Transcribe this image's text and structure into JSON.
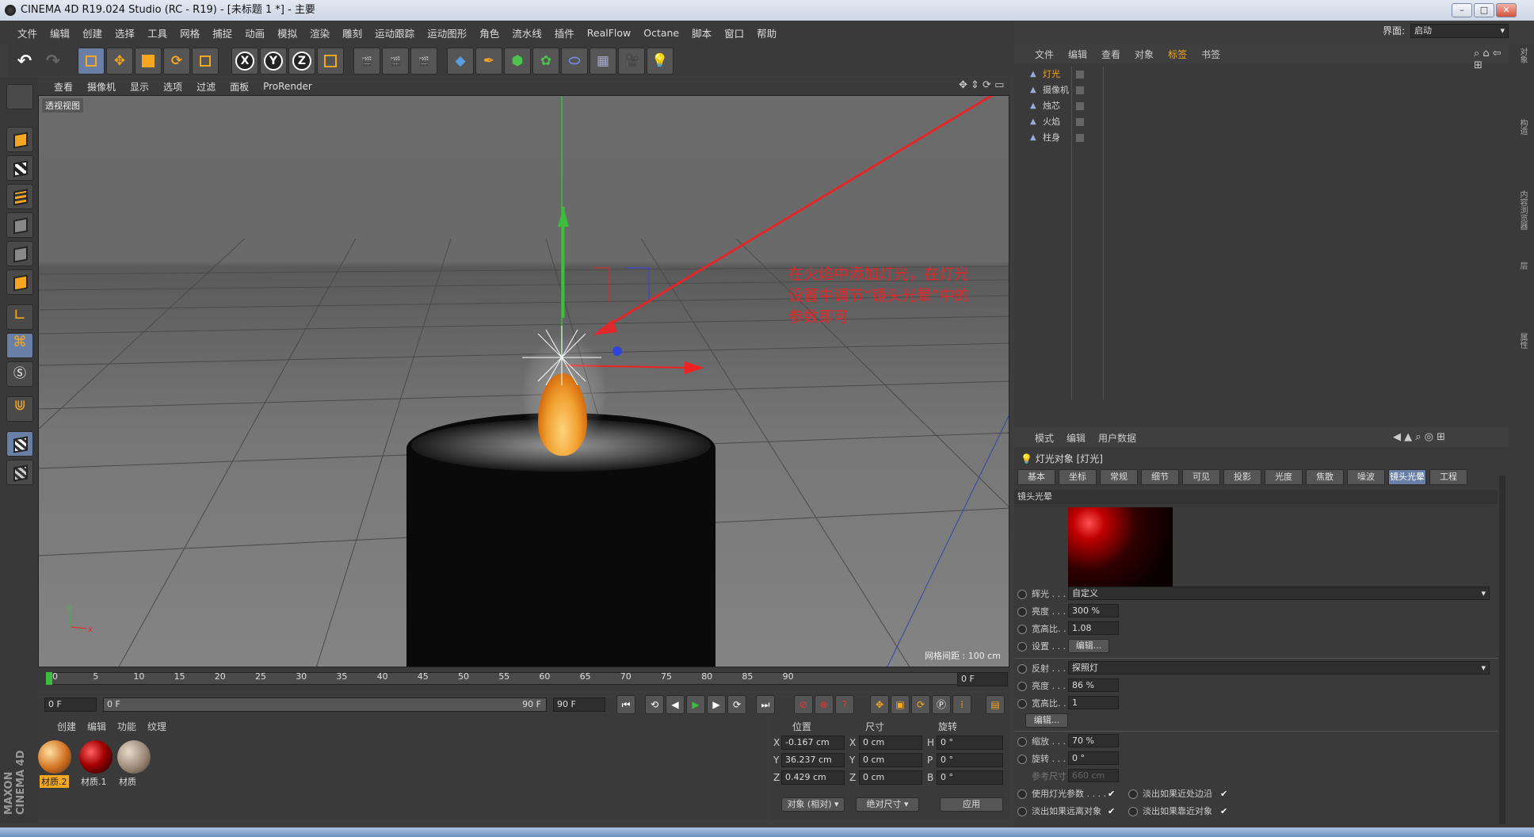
{
  "window": {
    "title": "CINEMA 4D R19.024 Studio (RC - R19) - [未标题 1 *] - 主要"
  },
  "menu": [
    "文件",
    "编辑",
    "创建",
    "选择",
    "工具",
    "网格",
    "捕捉",
    "动画",
    "模拟",
    "渲染",
    "雕刻",
    "运动跟踪",
    "运动图形",
    "角色",
    "流水线",
    "插件",
    "RealFlow",
    "Octane",
    "脚本",
    "窗口",
    "帮助"
  ],
  "interface": {
    "label": "界面:",
    "value": "启动"
  },
  "toolbar": {
    "x_label": "X",
    "y_label": "Y",
    "z_label": "Z"
  },
  "viewport": {
    "menu": [
      "查看",
      "摄像机",
      "显示",
      "选项",
      "过滤",
      "面板",
      "ProRender"
    ],
    "view_label": "透视视图",
    "grid_spacing": "网格间距 : 100 cm",
    "annotation": "在火焰中添加灯光，在灯光设置中调节“镜头光晕”中的参数即可"
  },
  "timeline": {
    "ticks": [
      "0",
      "5",
      "10",
      "15",
      "20",
      "25",
      "30",
      "35",
      "40",
      "45",
      "50",
      "55",
      "60",
      "65",
      "70",
      "75",
      "80",
      "85",
      "90"
    ],
    "current_frame": "0 F",
    "start": "0 F",
    "range_start": "0 F",
    "range_end": "90 F",
    "end": "90 F"
  },
  "materials": {
    "menu": [
      "创建",
      "编辑",
      "功能",
      "纹理"
    ],
    "items": [
      {
        "label": "材质.2",
        "color": "#a06030"
      },
      {
        "label": "材质.1",
        "color": "#8a0000"
      },
      {
        "label": "材质",
        "color": "#8b7b6b"
      }
    ],
    "brand": "MAXON CINEMA 4D"
  },
  "coords": {
    "headers": [
      "位置",
      "尺寸",
      "旋转"
    ],
    "rows": [
      {
        "axis": "X",
        "pos": "-0.167 cm",
        "size_axis": "X",
        "size": "0 cm",
        "rot_axis": "H",
        "rot": "0 °"
      },
      {
        "axis": "Y",
        "pos": "36.237 cm",
        "size_axis": "Y",
        "size": "0 cm",
        "rot_axis": "P",
        "rot": "0 °"
      },
      {
        "axis": "Z",
        "pos": "0.429 cm",
        "size_axis": "Z",
        "size": "0 cm",
        "rot_axis": "B",
        "rot": "0 °"
      }
    ],
    "mode": "对象 (相对)",
    "size_mode": "绝对尺寸",
    "apply": "应用"
  },
  "object_manager": {
    "menu": [
      "文件",
      "编辑",
      "查看",
      "对象",
      "标签",
      "书签"
    ],
    "objects": [
      "灯光",
      "摄像机",
      "烛芯",
      "火焰",
      "柱身"
    ]
  },
  "attributes": {
    "menu": [
      "模式",
      "编辑",
      "用户数据"
    ],
    "object_title": "灯光对象 [灯光]",
    "tabs": [
      "基本",
      "坐标",
      "常规",
      "细节",
      "可见",
      "投影",
      "光度",
      "焦散",
      "噪波",
      "镜头光晕",
      "工程"
    ],
    "active_tab": "镜头光晕",
    "section": "镜头光晕",
    "rows": {
      "glow_label": "辉光 . . .",
      "glow_value": "自定义",
      "brightness_label": "亮度 . . .",
      "brightness_value": "300 %",
      "aspect_label": "宽高比. .",
      "aspect_value": "1.08",
      "settings_label": "设置 . . .",
      "settings_btn": "编辑...",
      "reflex_label": "反射 . . .",
      "reflex_value": "探照灯",
      "brightness2_label": "亮度 . . .",
      "brightness2_value": "86 %",
      "aspect2_label": "宽高比. .",
      "aspect2_value": "1",
      "edit_btn": "编辑...",
      "scale_label": "缩放 . . .",
      "scale_value": "70 %",
      "rotate_label": "旋转 . . .",
      "rotate_value": "0 °",
      "refsize_label": "参考尺寸",
      "refsize_value": "660 cm",
      "use_light_params": "使用灯光参数 . . . .",
      "fade_edge": "淡出如果近处边沿",
      "fade_behind": "淡出如果远离对象",
      "fade_near": "淡出如果靠近对象"
    }
  },
  "right_strip": [
    "对象",
    "构造",
    "内容浏览器",
    "层",
    "属性"
  ]
}
